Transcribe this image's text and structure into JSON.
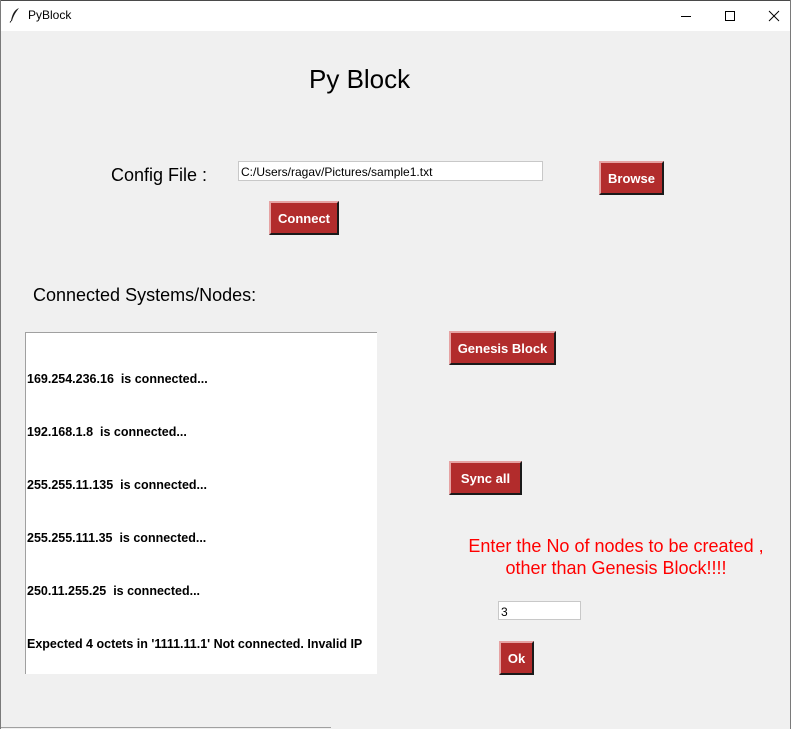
{
  "window": {
    "title": "PyBlock",
    "icon": "feather-icon",
    "controls": [
      "minimize-icon",
      "maximize-icon",
      "close-icon"
    ]
  },
  "main": {
    "heading": "Py Block",
    "config_label": "Config File :",
    "config_path": "C:/Users/ragav/Pictures/sample1.txt",
    "browse_label": "Browse",
    "connect_label": "Connect",
    "nodes_label": "Connected Systems/Nodes:",
    "node_lines": [
      "169.254.236.16  is connected...",
      "192.168.1.8  is connected...",
      "255.255.11.135  is connected...",
      "255.255.111.35  is connected...",
      "250.11.255.25  is connected...",
      "Expected 4 octets in '1111.11.1' Not connected. Invalid IP"
    ],
    "genesis_label": "Genesis Block",
    "sync_label": "Sync all",
    "prompt_line1": "Enter the No of nodes to be created ,",
    "prompt_line2": "other than Genesis Block!!!!",
    "nodes_count": "3",
    "ok_label": "Ok"
  },
  "colors": {
    "button_bg": "#b22c2c",
    "button_text": "#ffffff",
    "prompt_text": "#ff0000",
    "window_bg": "#f0f0f0"
  }
}
